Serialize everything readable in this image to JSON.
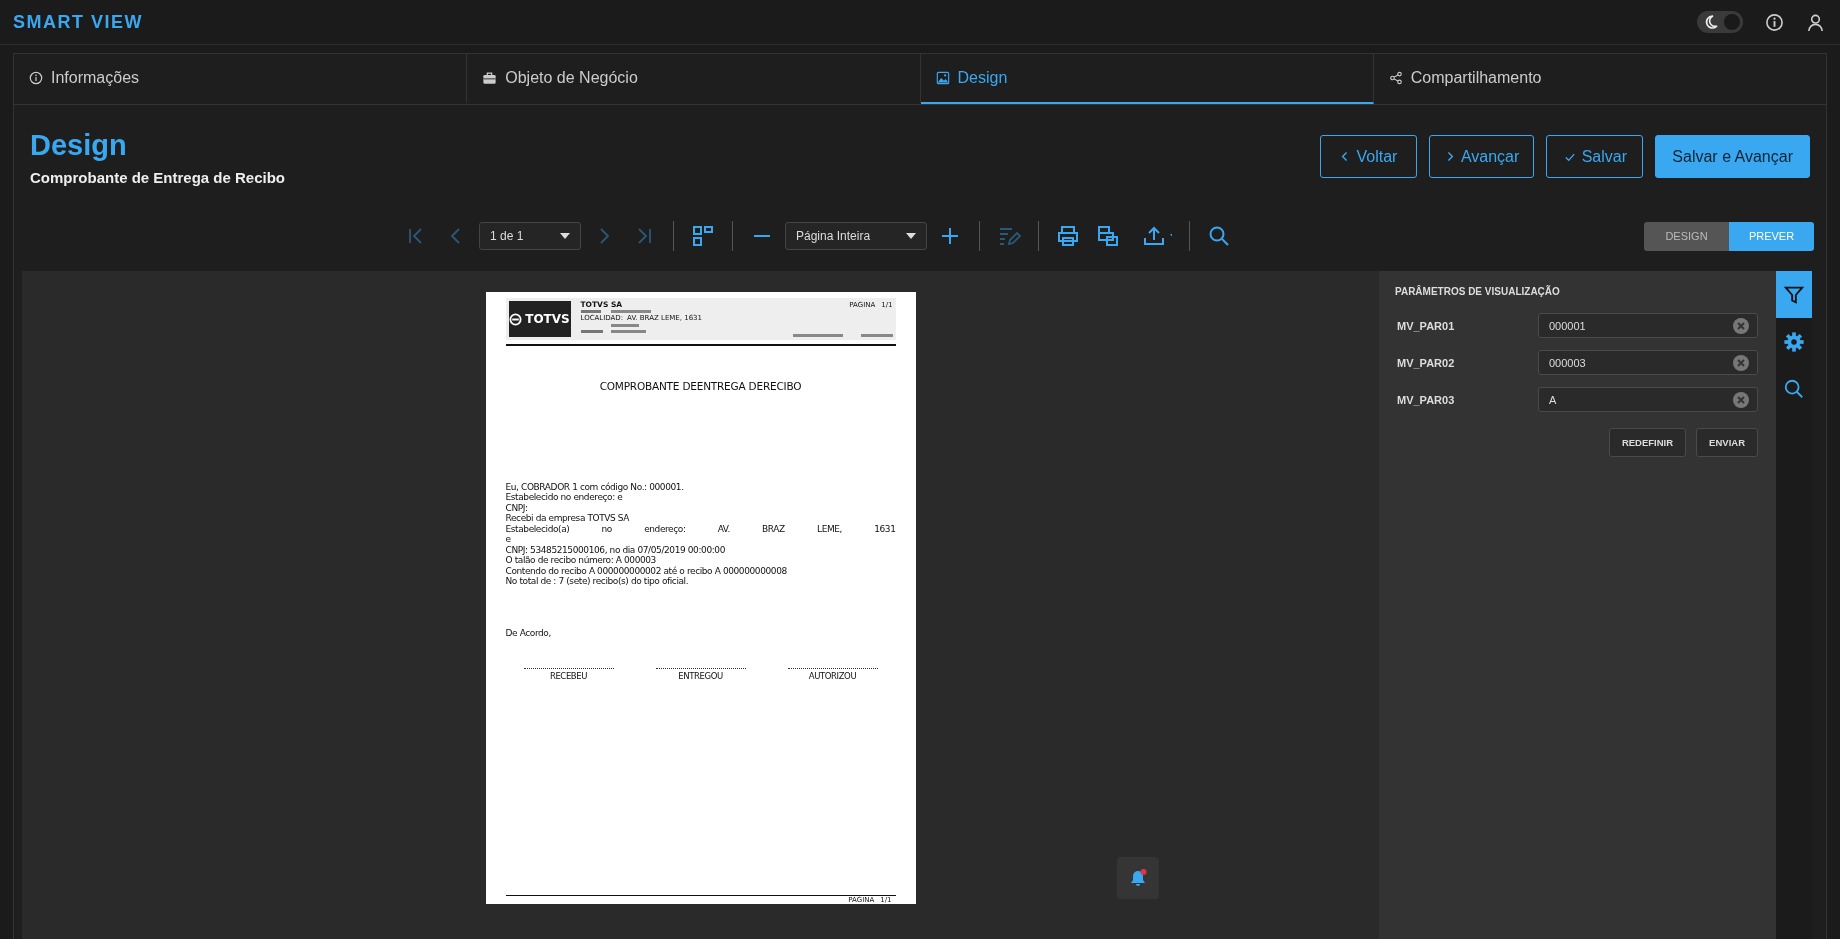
{
  "app": {
    "title": "SMART VIEW",
    "dark_mode": true
  },
  "tabs": [
    {
      "label": "Informações",
      "selected": false
    },
    {
      "label": "Objeto de Negócio",
      "selected": false
    },
    {
      "label": "Design",
      "selected": true
    },
    {
      "label": "Compartilhamento",
      "selected": false
    }
  ],
  "page_header": {
    "title": "Design",
    "subtitle": "Comprobante de Entrega de Recibo"
  },
  "actions": [
    {
      "label": "Voltar",
      "kind": "back"
    },
    {
      "label": "Avançar",
      "kind": "forward"
    },
    {
      "label": "Salvar",
      "kind": "save"
    },
    {
      "label": "Salvar e Avançar",
      "kind": "primary"
    }
  ],
  "toolbar": [
    {
      "kind": "first",
      "disabled": true
    },
    {
      "kind": "prev",
      "disabled": true
    },
    {
      "kind": "select",
      "value": "1 de 1",
      "disabled": false
    },
    {
      "kind": "next",
      "disabled": true
    },
    {
      "kind": "last",
      "disabled": true
    },
    {
      "kind": "separator"
    },
    {
      "kind": "layout",
      "disabled": false
    },
    {
      "kind": "separator"
    },
    {
      "kind": "zoom-out",
      "disabled": false
    },
    {
      "kind": "select",
      "value": "Página Inteira",
      "disabled": false
    },
    {
      "kind": "zoom-in",
      "disabled": false
    },
    {
      "kind": "separator"
    },
    {
      "kind": "edit",
      "disabled": true
    },
    {
      "kind": "separator"
    },
    {
      "kind": "print",
      "disabled": false
    },
    {
      "kind": "print-range",
      "disabled": false
    },
    {
      "kind": "export",
      "disabled": false
    },
    {
      "kind": "separator"
    },
    {
      "kind": "search",
      "disabled": false
    }
  ],
  "mode_switch": [
    {
      "label": "DESIGN",
      "selected": false
    },
    {
      "label": "PREVER",
      "selected": true
    }
  ],
  "document": {
    "logo": "TOTVS",
    "company": "TOTVS SA",
    "header_fields": [
      {
        "label": "LOCALIDAD:",
        "value": "AV. BRAZ LEME, 1631"
      }
    ],
    "header_page_label": "PAGINA",
    "header_page_number": "1/1",
    "footer_page_label": "PAGINA",
    "footer_page_number": "1/1",
    "title": "COMPROBANTE DEENTREGA DERECIBO",
    "lines": [
      {
        "text": "Eu, COBRADOR 1 com código No.: 000001.",
        "kind": "plain"
      },
      {
        "text": "Estabelecido no endereço: e",
        "kind": "plain"
      },
      {
        "text": "CNPJ:",
        "kind": "plain"
      },
      {
        "text": "Recebi da empresa TOTVS SA",
        "kind": "plain"
      },
      {
        "text": "Estabelecido(a) no endereço: AV. BRAZ LEME, 1631",
        "kind": "justified"
      },
      {
        "text": "e",
        "kind": "plain"
      },
      {
        "text": "CNPJ: 53485215000106, no dia 07/05/2019 00:00:00",
        "kind": "plain"
      },
      {
        "text": "O talão de recibo número: A 000003",
        "kind": "plain"
      },
      {
        "text": "Contendo do recibo A 000000000002 até o recibo A 000000000008",
        "kind": "plain"
      },
      {
        "text": "No total de : 7 (sete) recibo(s) do tipo oficial.",
        "kind": "plain"
      }
    ],
    "closing": "De Acordo,",
    "signatures": [
      "RECEBEU",
      "ENTREGOU",
      "AUTORIZOU"
    ]
  },
  "parameters": {
    "title": "PARÂMETROS DE VISUALIZAÇÃO",
    "fields": [
      {
        "name": "MV_PAR01",
        "value": "000001"
      },
      {
        "name": "MV_PAR02",
        "value": "000003"
      },
      {
        "name": "MV_PAR03",
        "value": "A"
      }
    ],
    "buttons": [
      "REDEFINIR",
      "ENVIAR"
    ]
  },
  "side_rail": [
    {
      "selected": true
    },
    {
      "selected": false
    },
    {
      "selected": false
    }
  ],
  "notifications": {
    "unread": true
  }
}
